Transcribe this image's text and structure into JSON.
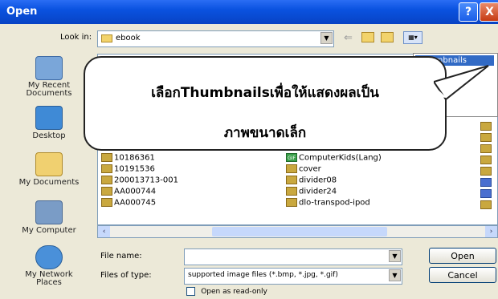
{
  "window": {
    "title": "Open",
    "help": "?",
    "close": "X"
  },
  "look_in": {
    "label": "Look in:",
    "value": "ebook"
  },
  "places": [
    {
      "label": "My Recent\nDocuments",
      "icon": "recent-docs-icon"
    },
    {
      "label": "Desktop",
      "icon": "desktop-icon"
    },
    {
      "label": "My Documents",
      "icon": "my-documents-icon"
    },
    {
      "label": "My Computer",
      "icon": "my-computer-icon"
    },
    {
      "label": "My Network\nPlaces",
      "icon": "network-places-icon"
    }
  ],
  "files_col1": [
    "10186361",
    "10191536",
    "200013713-001",
    "AA000744",
    "AA000745"
  ],
  "files_col2": [
    "ComputerKids(Lang)",
    "cover",
    "divider08",
    "divider24",
    "dlo-transpod-ipod"
  ],
  "file_badges": [
    "GIF"
  ],
  "view_menu": {
    "selected": "humbnails"
  },
  "callout": {
    "line1": "เลือกThumbnailsเพื่อให้แสดงผลเป็น",
    "line2": "ภาพขนาดเล็ก"
  },
  "file_name": {
    "label": "File name:",
    "value": ""
  },
  "file_type": {
    "label": "Files of type:",
    "value": "supported image files (*.bmp, *.jpg, *.gif)"
  },
  "read_only": {
    "label": "Open as read-only"
  },
  "buttons": {
    "open": "Open",
    "cancel": "Cancel"
  }
}
